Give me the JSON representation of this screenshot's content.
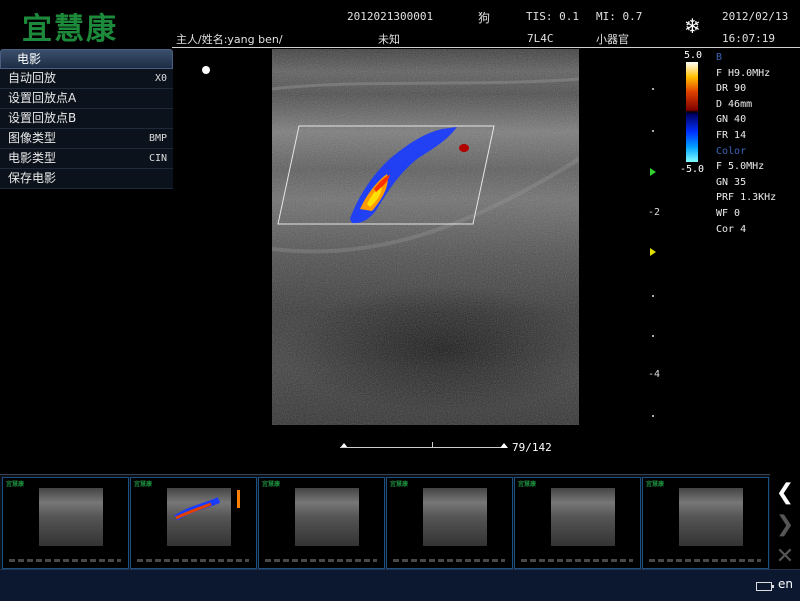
{
  "header": {
    "logo": "宜慧康",
    "patient_id": "2012021300001",
    "species": "狗",
    "tis": "TIS: 0.1",
    "mi": "MI: 0.7",
    "date": "2012/02/13",
    "owner_name": "主人/姓名:yang ben/",
    "unknown": "未知",
    "probe": "7L4C",
    "preset": "小器官",
    "time": "16:07:19",
    "freeze_icon": "snowflake-icon"
  },
  "menu": {
    "title": "电影",
    "items": [
      {
        "label": "自动回放",
        "value": "X0"
      },
      {
        "label": "设置回放点A",
        "value": ""
      },
      {
        "label": "设置回放点B",
        "value": ""
      },
      {
        "label": "图像类型",
        "value": "BMP"
      },
      {
        "label": "电影类型",
        "value": "CIN"
      },
      {
        "label": "保存电影",
        "value": ""
      }
    ]
  },
  "colorbar": {
    "top": "5.0",
    "bottom": "-5.0"
  },
  "params": {
    "b_title": "B",
    "b": [
      "F   H9.0MHz",
      "DR  90",
      "D   46mm",
      "GN  40",
      "FR  14"
    ],
    "color_title": "Color",
    "color": [
      "F   5.0MHz",
      "GN  35",
      "PRF 1.3KHz",
      "WF  0",
      "Cor 4"
    ]
  },
  "scale": {
    "mark_2": "-2",
    "mark_4": "-4"
  },
  "cine": {
    "frame": "79/142"
  },
  "thumbnails": {
    "logo": "宜慧康",
    "count": 6
  },
  "side_buttons": {
    "prev": "❮",
    "next": "❯",
    "close": "✕"
  },
  "status": {
    "language": "en",
    "battery_icon": "battery-icon"
  }
}
